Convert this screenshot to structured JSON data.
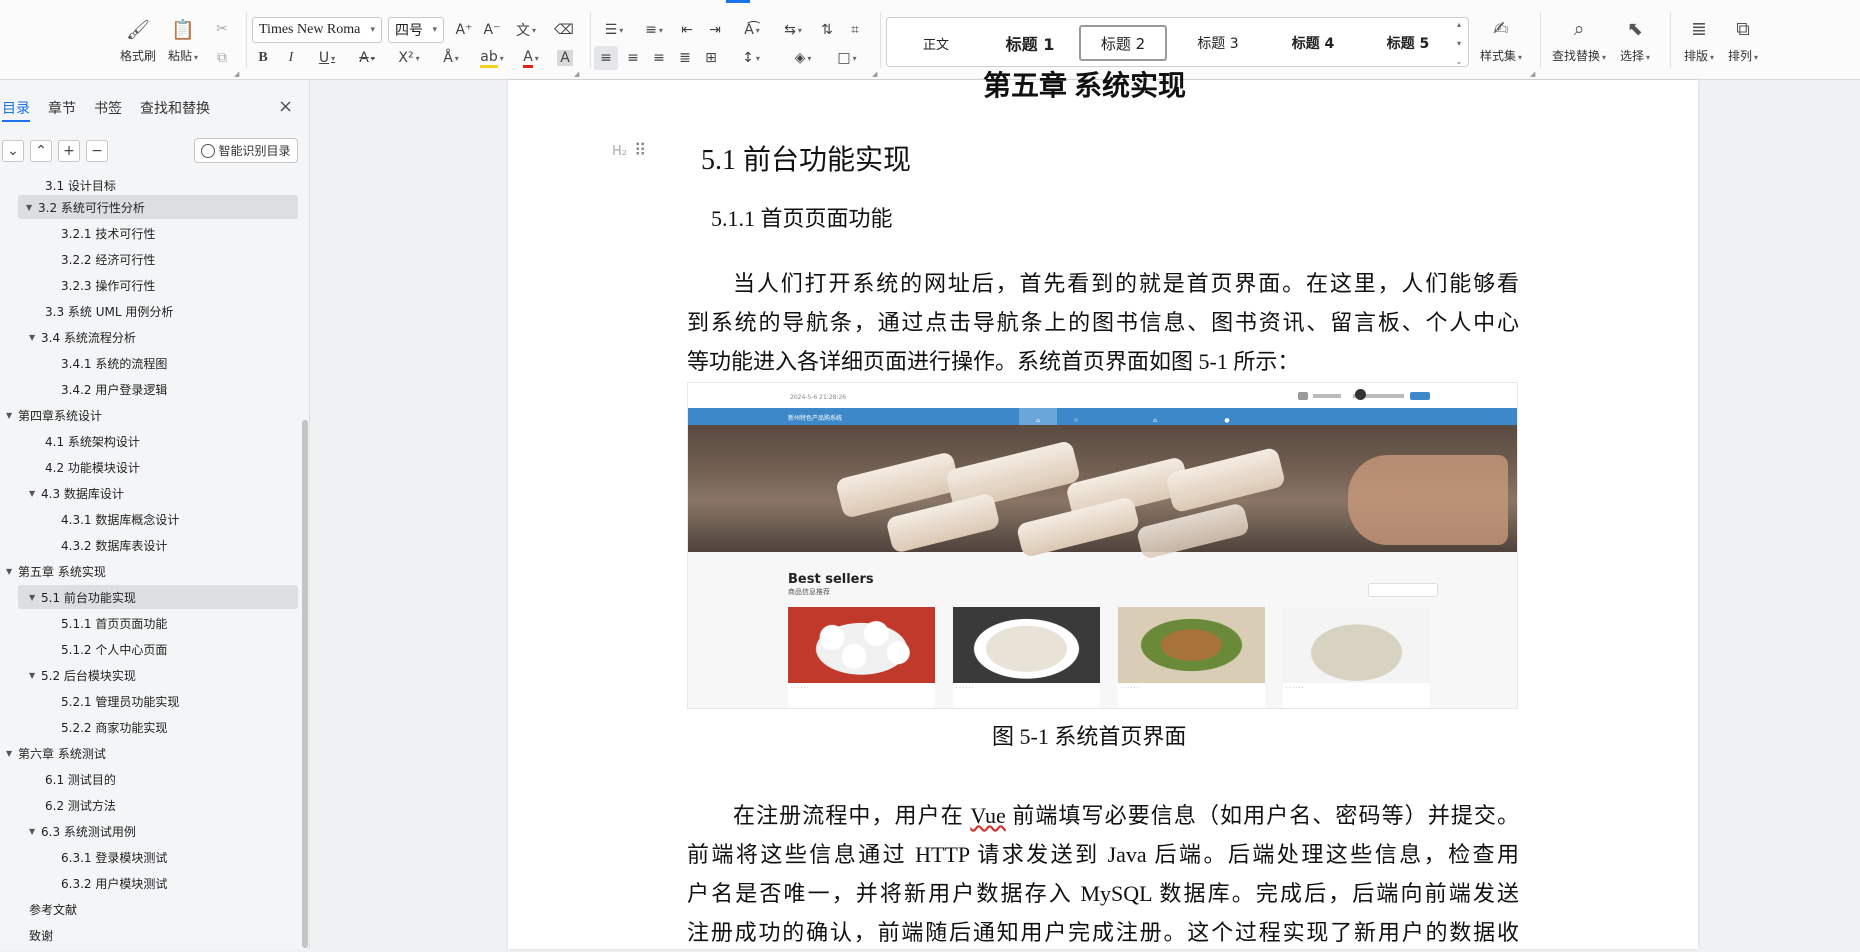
{
  "ribbon": {
    "format_painter": "格式刷",
    "paste": "粘贴",
    "font_name": "Times New Roma",
    "font_size": "四号",
    "styles": [
      "正文",
      "标题 1",
      "标题 2",
      "标题 3",
      "标题 4",
      "标题 5"
    ],
    "style_set": "样式集",
    "find_replace": "查找替换",
    "select": "选择",
    "layout": "排版",
    "arrange": "排列"
  },
  "panel": {
    "tabs": [
      "目录",
      "章节",
      "书签",
      "查找和替换"
    ],
    "ai_toc": "智能识别目录",
    "toc": [
      {
        "label": "3.1 设计目标"
      },
      {
        "label": "3.2 系统可行性分析"
      },
      {
        "label": "3.2.1 技术可行性"
      },
      {
        "label": "3.2.2 经济可行性"
      },
      {
        "label": "3.2.3 操作可行性"
      },
      {
        "label": "3.3 系统 UML 用例分析"
      },
      {
        "label": "3.4 系统流程分析"
      },
      {
        "label": "3.4.1 系统的流程图"
      },
      {
        "label": "3.4.2 用户登录逻辑"
      },
      {
        "label": "第四章系统设计"
      },
      {
        "label": "4.1  系统架构设计"
      },
      {
        "label": "4.2 功能模块设计"
      },
      {
        "label": "4.3  数据库设计"
      },
      {
        "label": "4.3.1 数据库概念设计"
      },
      {
        "label": "4.3.2  数据库表设计"
      },
      {
        "label": "第五章  系统实现"
      },
      {
        "label": "5.1 前台功能实现"
      },
      {
        "label": "5.1.1 首页页面功能"
      },
      {
        "label": "5.1.2 个人中心页面"
      },
      {
        "label": "5.2 后台模块实现"
      },
      {
        "label": "5.2.1 管理员功能实现"
      },
      {
        "label": "5.2.2 商家功能实现"
      },
      {
        "label": "第六章  系统测试"
      },
      {
        "label": "6.1 测试目的"
      },
      {
        "label": "6.2 测试方法"
      },
      {
        "label": "6.3 系统测试用例"
      },
      {
        "label": "6.3.1 登录模块测试"
      },
      {
        "label": "6.3.2 用户模块测试"
      },
      {
        "label": "参考文献"
      },
      {
        "label": "致谢"
      }
    ]
  },
  "doc": {
    "chapter_partial": "第五章  系统实现",
    "h2_mark": "H₂",
    "h2": "5.1 前台功能实现",
    "h3": "5.1.1 首页页面功能",
    "para1": [
      "当人们打开系统的网址后，首先看到的就是首页界面。在这里，人们能够看",
      "到系统的导航条，通过点击导航条上的图书信息、图书资讯、留言板、个人中心",
      "等功能进入各详细页面进行操作。系统首页界面如图 5-1 所示："
    ],
    "caption": "图 5-1  系统首页界面",
    "para2": {
      "l1_a": "在注册流程中，用户在 ",
      "l1_vue": "Vue",
      "l1_b": " 前端填写必要信息（如用户名、密码等）并提交。",
      "lines": [
        "前端将这些信息通过 HTTP 请求发送到 Java 后端。后端处理这些信息，检查用",
        "户名是否唯一，并将新用户数据存入 MySQL 数据库。完成后，后端向前端发送",
        "注册成功的确认，前端随后通知用户完成注册。这个过程实现了新用户的数据收"
      ]
    },
    "screenshot": {
      "date": "2024-5-6 21:28:26",
      "site_title": "新州特色产品购系统",
      "best_sellers": "Best sellers",
      "best_sellers_sub": "商品信息推荐"
    }
  }
}
